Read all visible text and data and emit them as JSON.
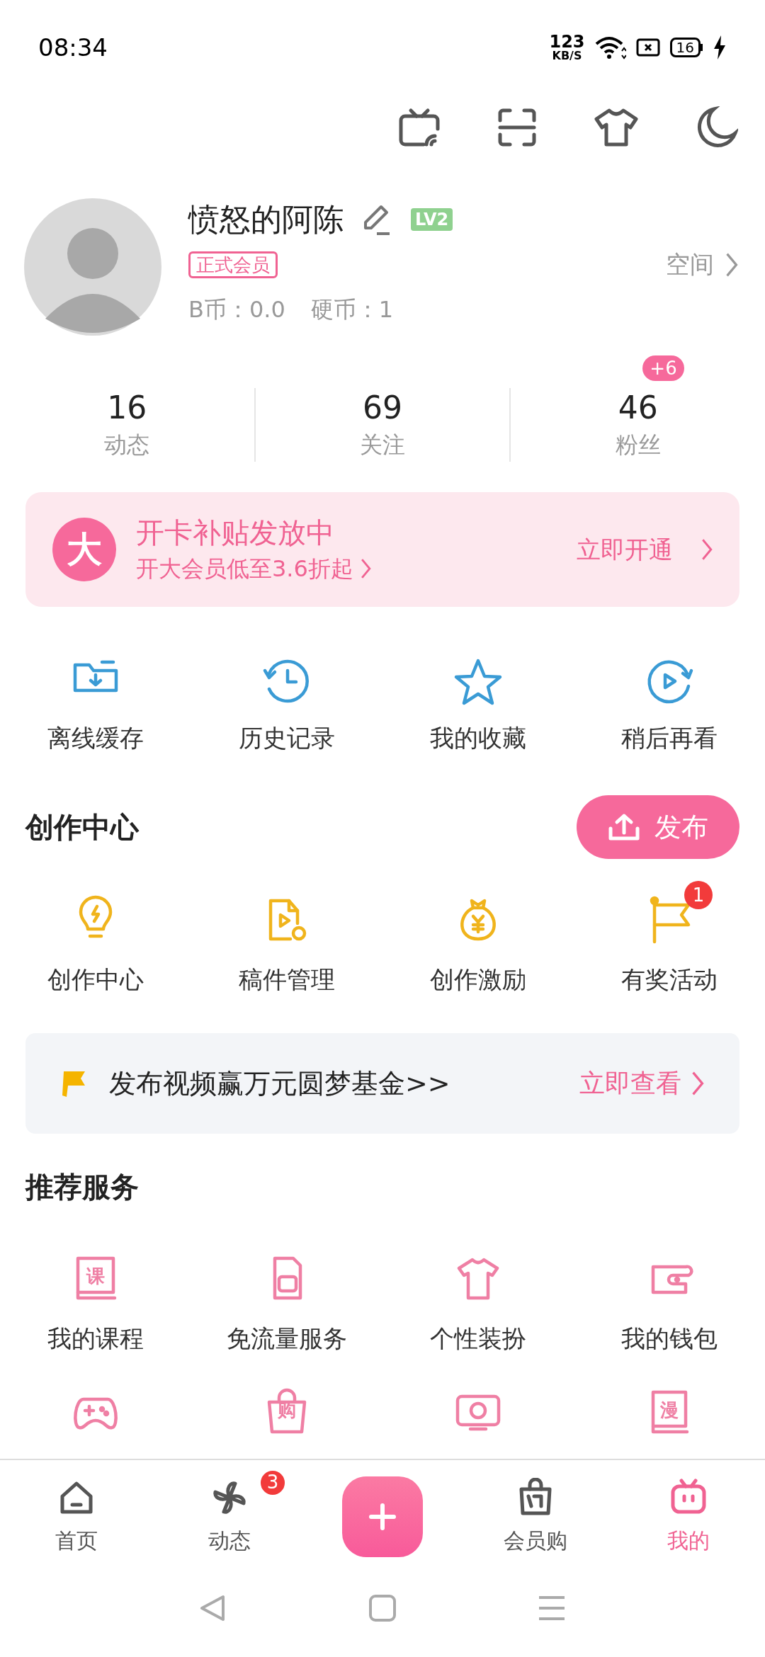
{
  "status_bar": {
    "time": "08:34",
    "net_speed": [
      "123",
      "KB/S"
    ],
    "battery": "16"
  },
  "profile": {
    "name": "愤怒的阿陈",
    "level": "LV2",
    "member_badge": "正式会员",
    "b_coins": "B币：0.0",
    "coins": "硬币：1",
    "space_link": "空间"
  },
  "stats": [
    {
      "value": "16",
      "label": "动态"
    },
    {
      "value": "69",
      "label": "关注"
    },
    {
      "value": "46",
      "label": "粉丝",
      "badge": "+6"
    }
  ],
  "vip_banner": {
    "icon_glyph": "大",
    "title": "开卡补贴发放中",
    "subtitle": "开大会员低至3.6折起",
    "action": "立即开通"
  },
  "quick_actions": [
    {
      "label": "离线缓存"
    },
    {
      "label": "历史记录"
    },
    {
      "label": "我的收藏"
    },
    {
      "label": "稍后再看"
    }
  ],
  "creator_center": {
    "title": "创作中心",
    "publish_button": "发布",
    "items": [
      {
        "label": "创作中心"
      },
      {
        "label": "稿件管理"
      },
      {
        "label": "创作激励"
      },
      {
        "label": "有奖活动",
        "badge": "1"
      }
    ]
  },
  "promo": {
    "text": "发布视频赢万元圆梦基金>>",
    "action": "立即查看"
  },
  "services": {
    "title": "推荐服务",
    "items": [
      {
        "kind": "service",
        "label": "我的课程",
        "glyph": "课"
      },
      {
        "kind": "service",
        "label": "免流量服务"
      },
      {
        "kind": "service",
        "label": "个性装扮"
      },
      {
        "kind": "service",
        "label": "我的钱包"
      },
      {
        "kind": "service"
      },
      {
        "kind": "service",
        "glyph": "购"
      },
      {
        "kind": "service"
      },
      {
        "kind": "service",
        "glyph": "漫"
      }
    ]
  },
  "tab_bar": [
    {
      "kind": "tab",
      "label": "首页",
      "selected": false
    },
    {
      "kind": "tab",
      "label": "动态",
      "badge": "3",
      "selected": false
    },
    {
      "kind": "publish"
    },
    {
      "kind": "tab",
      "label": "会员购",
      "selected": false
    },
    {
      "kind": "tab",
      "label": "我的",
      "selected": true
    }
  ]
}
